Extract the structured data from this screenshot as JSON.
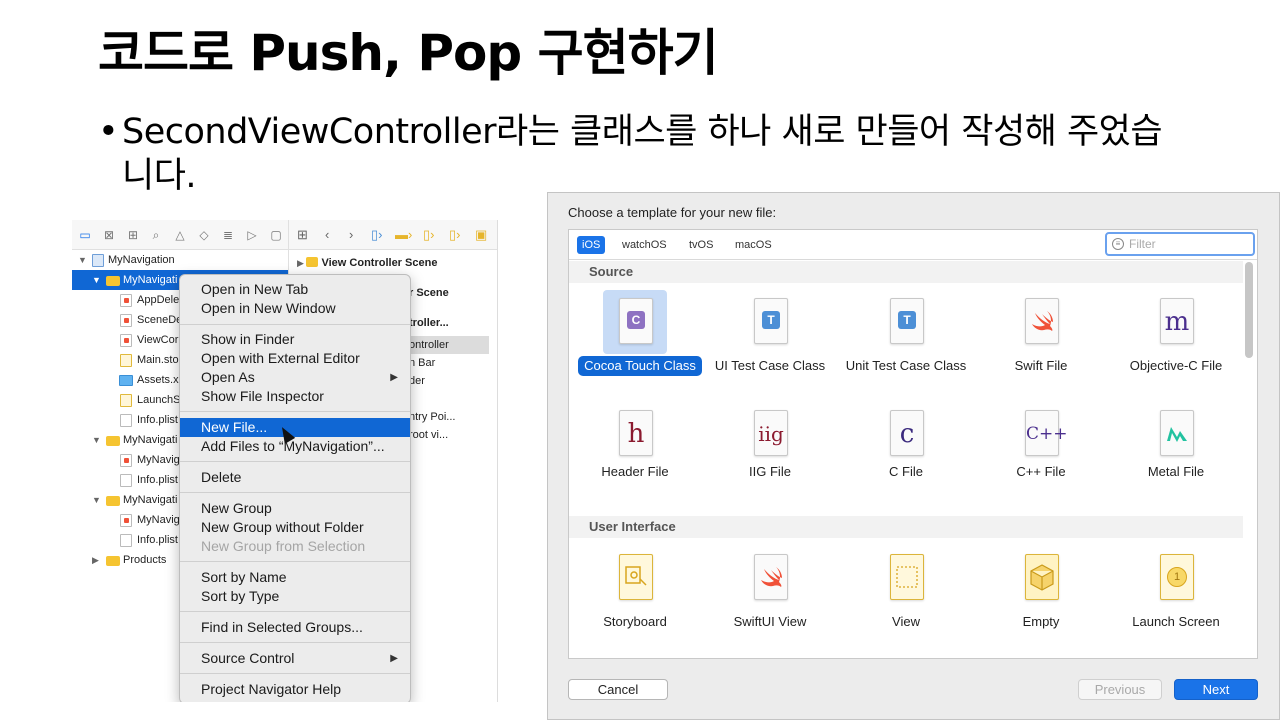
{
  "slide": {
    "title": "코드로 Push, Pop 구현하기",
    "bullet_dot": "•",
    "bullet_text": "SecondViewController라는 클래스를 하나 새로 만들어 작성해 주었습니다."
  },
  "navigator": {
    "rows": [
      {
        "label": "MyNavigation"
      },
      {
        "label": "MyNavigati"
      },
      {
        "label": "AppDele"
      },
      {
        "label": "SceneDe"
      },
      {
        "label": "ViewCor"
      },
      {
        "label": "Main.sto"
      },
      {
        "label": "Assets.x"
      },
      {
        "label": "LaunchS"
      },
      {
        "label": "Info.plist"
      },
      {
        "label": "MyNavigati"
      },
      {
        "label": "MyNavig"
      },
      {
        "label": "Info.plist"
      },
      {
        "label": "MyNavigati"
      },
      {
        "label": "MyNavig"
      },
      {
        "label": "Info.plist"
      },
      {
        "label": "Products"
      }
    ],
    "scene_rows": [
      {
        "label": "View Controller Scene"
      },
      {
        "label": "r Scene"
      },
      {
        "label": "troller..."
      },
      {
        "label": "ontroller"
      },
      {
        "label": "n Bar"
      },
      {
        "label": "der"
      },
      {
        "label": "ntry Poi..."
      },
      {
        "label": "root vi..."
      }
    ]
  },
  "context_menu": {
    "items": [
      {
        "label": "Open in New Tab"
      },
      {
        "label": "Open in New Window"
      },
      {
        "label": "Show in Finder"
      },
      {
        "label": "Open with External Editor"
      },
      {
        "label": "Open As"
      },
      {
        "label": "Show File Inspector"
      },
      {
        "label": "New File..."
      },
      {
        "label": "Add Files to “MyNavigation”..."
      },
      {
        "label": "Delete"
      },
      {
        "label": "New Group"
      },
      {
        "label": "New Group without Folder"
      },
      {
        "label": "New Group from Selection"
      },
      {
        "label": "Sort by Name"
      },
      {
        "label": "Sort by Type"
      },
      {
        "label": "Find in Selected Groups..."
      },
      {
        "label": "Source Control"
      },
      {
        "label": "Project Navigator Help"
      }
    ],
    "submenu_arrow": "▶"
  },
  "template_dialog": {
    "prompt": "Choose a template for your new file:",
    "platform_tabs": [
      "iOS",
      "watchOS",
      "tvOS",
      "macOS"
    ],
    "filter_placeholder": "Filter",
    "sections": [
      "Source",
      "User Interface"
    ],
    "source_templates": [
      {
        "label": "Cocoa Touch Class",
        "glyph": "C",
        "icon": "cocoa-touch-class-icon"
      },
      {
        "label": "UI Test Case Class",
        "glyph": "T",
        "icon": "ui-test-case-icon"
      },
      {
        "label": "Unit Test Case Class",
        "glyph": "T",
        "icon": "unit-test-case-icon"
      },
      {
        "label": "Swift File",
        "glyph": "",
        "icon": "swift-icon"
      },
      {
        "label": "Objective-C File",
        "glyph": "m",
        "icon": "objc-m-icon"
      },
      {
        "label": "Header File",
        "glyph": "h",
        "icon": "header-h-icon"
      },
      {
        "label": "IIG File",
        "glyph": "iig",
        "icon": "iig-icon"
      },
      {
        "label": "C File",
        "glyph": "c",
        "icon": "c-file-icon"
      },
      {
        "label": "C++ File",
        "glyph": "C++",
        "icon": "cpp-file-icon"
      },
      {
        "label": "Metal File",
        "glyph": "",
        "icon": "metal-icon"
      }
    ],
    "ui_templates": [
      {
        "label": "Storyboard",
        "icon": "storyboard-icon"
      },
      {
        "label": "SwiftUI View",
        "icon": "swiftui-icon"
      },
      {
        "label": "View",
        "icon": "view-icon"
      },
      {
        "label": "Empty",
        "icon": "empty-cube-icon"
      },
      {
        "label": "Launch Screen",
        "glyph": "1",
        "icon": "launch-screen-icon"
      }
    ],
    "buttons": {
      "cancel": "Cancel",
      "previous": "Previous",
      "next": "Next"
    }
  },
  "colors": {
    "selection_blue": "#1067d4",
    "accent_blue": "#1a73e8",
    "swift_orange": "#f05138",
    "cocoa_purple": "#8e72c2",
    "test_blue": "#4c8fd6",
    "metal_teal": "#22c2a0"
  }
}
